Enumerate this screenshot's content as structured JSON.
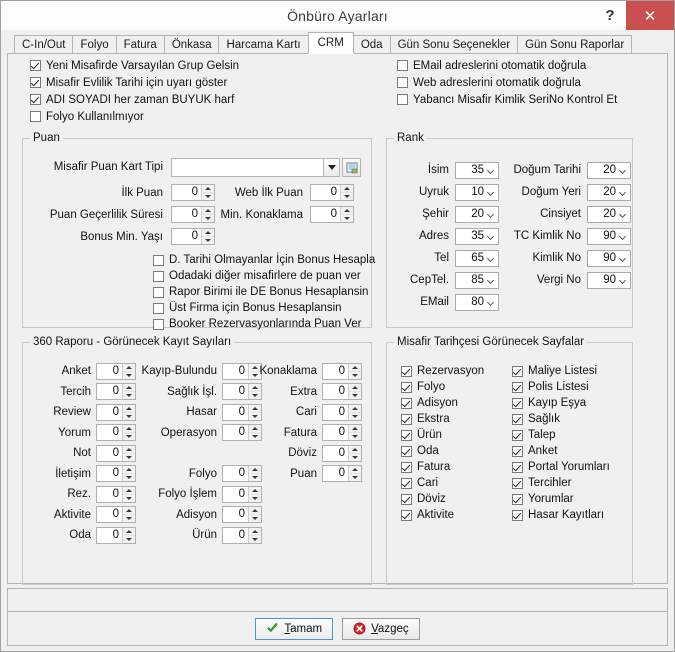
{
  "window": {
    "title": "Önbüro Ayarları",
    "help_label": "?",
    "close_label": "✕",
    "accent_close": "#c9504f",
    "accent_default_button": "#4b93d1"
  },
  "tabs": [
    {
      "label": "C-In/Out",
      "active": false
    },
    {
      "label": "Folyo",
      "active": false
    },
    {
      "label": "Fatura",
      "active": false
    },
    {
      "label": "Önkasa",
      "active": false
    },
    {
      "label": "Harcama Kartı",
      "active": false
    },
    {
      "label": "CRM",
      "active": true
    },
    {
      "label": "Oda",
      "active": false
    },
    {
      "label": "Gün Sonu Seçenekler",
      "active": false
    },
    {
      "label": "Gün Sonu Raporlar",
      "active": false
    }
  ],
  "top_options": {
    "left": [
      {
        "label": "Yeni Misafirde Varsayılan Grup Gelsin",
        "checked": true
      },
      {
        "label": "Misafir Evlilik Tarihi için uyarı göster",
        "checked": true
      },
      {
        "label": "ADI SOYADI her zaman BUYUK harf",
        "checked": true
      },
      {
        "label": "Folyo Kullanılmıyor",
        "checked": false
      }
    ],
    "right": [
      {
        "label": "EMail adreslerini otomatik doğrula",
        "checked": false
      },
      {
        "label": "Web adreslerini otomatik doğrula",
        "checked": false
      },
      {
        "label": "Yabancı Misafir Kimlik SeriNo Kontrol Et",
        "checked": false
      }
    ]
  },
  "puan": {
    "title": "Puan",
    "card_type_label": "Misafir Puan Kart Tipi",
    "card_type_value": "",
    "card_type_placeholder": "",
    "browse_icon": "list-grid-icon",
    "fields": [
      {
        "label": "İlk Puan",
        "value": "0"
      },
      {
        "label": "Web İlk Puan",
        "value": "0"
      },
      {
        "label": "Puan Geçerlilik Süresi",
        "value": "0"
      },
      {
        "label": "Min. Konaklama",
        "value": "0"
      },
      {
        "label": "Bonus Min.  Yaşı",
        "value": "0"
      }
    ],
    "options": [
      {
        "label": "D. Tarihi Olmayanlar İçin Bonus Hesapla",
        "checked": false
      },
      {
        "label": "Odadaki diğer misafirlere de puan ver",
        "checked": false
      },
      {
        "label": "Rapor Birimi ile DE Bonus Hesaplansin",
        "checked": false
      },
      {
        "label": "Üst Firma için Bonus Hesaplansin",
        "checked": false
      },
      {
        "label": "Booker Rezervasyonlarında Puan Ver",
        "checked": false
      }
    ]
  },
  "rank": {
    "title": "Rank",
    "left": [
      {
        "label": "İsim",
        "value": "35"
      },
      {
        "label": "Uyruk",
        "value": "10"
      },
      {
        "label": "Şehir",
        "value": "20"
      },
      {
        "label": "Adres",
        "value": "35"
      },
      {
        "label": "Tel",
        "value": "65"
      },
      {
        "label": "CepTel.",
        "value": "85"
      },
      {
        "label": "EMail",
        "value": "80"
      }
    ],
    "right": [
      {
        "label": "Doğum Tarihi",
        "value": "20"
      },
      {
        "label": "Doğum Yeri",
        "value": "20"
      },
      {
        "label": "Cinsiyet",
        "value": "20"
      },
      {
        "label": "TC Kimlik No",
        "value": "90"
      },
      {
        "label": "Kimlik No",
        "value": "90"
      },
      {
        "label": "Vergi No",
        "value": "90"
      }
    ]
  },
  "rapor360": {
    "title": "360 Raporu - Görünecek Kayıt Sayıları",
    "col1": [
      {
        "label": "Anket",
        "value": "0"
      },
      {
        "label": "Tercih",
        "value": "0"
      },
      {
        "label": "Review",
        "value": "0"
      },
      {
        "label": "Yorum",
        "value": "0"
      },
      {
        "label": "Not",
        "value": "0"
      },
      {
        "label": "İletişim",
        "value": "0"
      },
      {
        "label": "Rez.",
        "value": "0"
      },
      {
        "label": "Aktivite",
        "value": "0"
      },
      {
        "label": "Oda",
        "value": "0"
      }
    ],
    "col2": [
      {
        "label": "Kayıp-Bulundu",
        "value": "0"
      },
      {
        "label": "Sağlık İşl.",
        "value": "0"
      },
      {
        "label": "Hasar",
        "value": "0"
      },
      {
        "label": "Operasyon",
        "value": "0"
      },
      {
        "label": "",
        "value": ""
      },
      {
        "label": "Folyo",
        "value": "0"
      },
      {
        "label": "Folyo İşlem",
        "value": "0"
      },
      {
        "label": "Adisyon",
        "value": "0"
      },
      {
        "label": "Ürün",
        "value": "0"
      }
    ],
    "col3": [
      {
        "label": "Konaklama",
        "value": "0"
      },
      {
        "label": "Extra",
        "value": "0"
      },
      {
        "label": "Cari",
        "value": "0"
      },
      {
        "label": "Fatura",
        "value": "0"
      },
      {
        "label": "Döviz",
        "value": "0"
      },
      {
        "label": "Puan",
        "value": "0"
      }
    ]
  },
  "history_pages": {
    "title": "Misafir Tarihçesi Görünecek Sayfalar",
    "left": [
      {
        "label": "Rezervasyon",
        "checked": true
      },
      {
        "label": "Folyo",
        "checked": true
      },
      {
        "label": "Adisyon",
        "checked": true
      },
      {
        "label": "Ekstra",
        "checked": true
      },
      {
        "label": "Ürün",
        "checked": true
      },
      {
        "label": "Oda",
        "checked": true
      },
      {
        "label": "Fatura",
        "checked": true
      },
      {
        "label": "Cari",
        "checked": true
      },
      {
        "label": "Döviz",
        "checked": true
      },
      {
        "label": "Aktivite",
        "checked": true
      }
    ],
    "right": [
      {
        "label": "Maliye Listesi",
        "checked": true
      },
      {
        "label": "Polis Listesi",
        "checked": true
      },
      {
        "label": "Kayıp Eşya",
        "checked": true
      },
      {
        "label": "Sağlık",
        "checked": true
      },
      {
        "label": "Talep",
        "checked": true
      },
      {
        "label": "Anket",
        "checked": true
      },
      {
        "label": "Portal Yorumları",
        "checked": true
      },
      {
        "label": "Tercihler",
        "checked": true
      },
      {
        "label": "Yorumlar",
        "checked": true
      },
      {
        "label": "Hasar Kayıtları",
        "checked": true
      }
    ]
  },
  "footer": {
    "ok_label_prefix": "",
    "ok_accel": "T",
    "ok_label_rest": "amam",
    "ok_full": "Tamam",
    "cancel_accel": "V",
    "cancel_label_rest": "azgeç",
    "cancel_full": "Vazgeç"
  }
}
